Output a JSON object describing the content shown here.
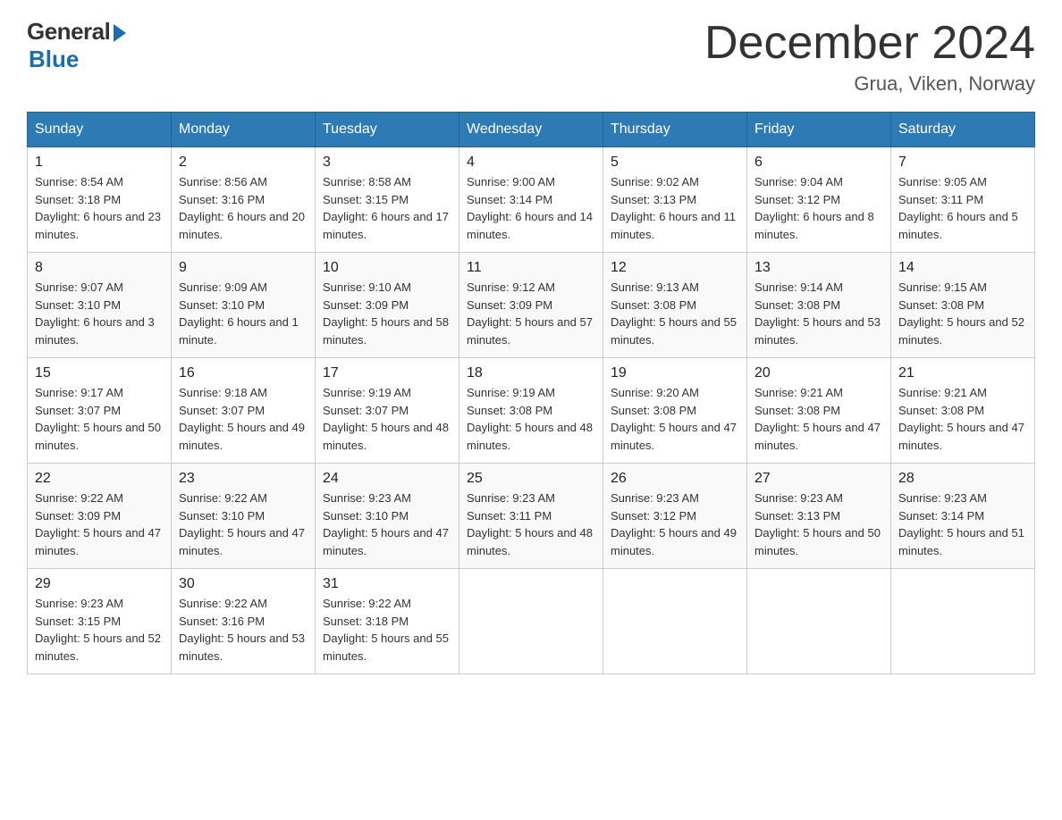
{
  "header": {
    "logo_general": "General",
    "logo_blue": "Blue",
    "month_title": "December 2024",
    "location": "Grua, Viken, Norway"
  },
  "days_of_week": [
    "Sunday",
    "Monday",
    "Tuesday",
    "Wednesday",
    "Thursday",
    "Friday",
    "Saturday"
  ],
  "weeks": [
    [
      {
        "day": "1",
        "sunrise": "8:54 AM",
        "sunset": "3:18 PM",
        "daylight": "6 hours and 23 minutes."
      },
      {
        "day": "2",
        "sunrise": "8:56 AM",
        "sunset": "3:16 PM",
        "daylight": "6 hours and 20 minutes."
      },
      {
        "day": "3",
        "sunrise": "8:58 AM",
        "sunset": "3:15 PM",
        "daylight": "6 hours and 17 minutes."
      },
      {
        "day": "4",
        "sunrise": "9:00 AM",
        "sunset": "3:14 PM",
        "daylight": "6 hours and 14 minutes."
      },
      {
        "day": "5",
        "sunrise": "9:02 AM",
        "sunset": "3:13 PM",
        "daylight": "6 hours and 11 minutes."
      },
      {
        "day": "6",
        "sunrise": "9:04 AM",
        "sunset": "3:12 PM",
        "daylight": "6 hours and 8 minutes."
      },
      {
        "day": "7",
        "sunrise": "9:05 AM",
        "sunset": "3:11 PM",
        "daylight": "6 hours and 5 minutes."
      }
    ],
    [
      {
        "day": "8",
        "sunrise": "9:07 AM",
        "sunset": "3:10 PM",
        "daylight": "6 hours and 3 minutes."
      },
      {
        "day": "9",
        "sunrise": "9:09 AM",
        "sunset": "3:10 PM",
        "daylight": "6 hours and 1 minute."
      },
      {
        "day": "10",
        "sunrise": "9:10 AM",
        "sunset": "3:09 PM",
        "daylight": "5 hours and 58 minutes."
      },
      {
        "day": "11",
        "sunrise": "9:12 AM",
        "sunset": "3:09 PM",
        "daylight": "5 hours and 57 minutes."
      },
      {
        "day": "12",
        "sunrise": "9:13 AM",
        "sunset": "3:08 PM",
        "daylight": "5 hours and 55 minutes."
      },
      {
        "day": "13",
        "sunrise": "9:14 AM",
        "sunset": "3:08 PM",
        "daylight": "5 hours and 53 minutes."
      },
      {
        "day": "14",
        "sunrise": "9:15 AM",
        "sunset": "3:08 PM",
        "daylight": "5 hours and 52 minutes."
      }
    ],
    [
      {
        "day": "15",
        "sunrise": "9:17 AM",
        "sunset": "3:07 PM",
        "daylight": "5 hours and 50 minutes."
      },
      {
        "day": "16",
        "sunrise": "9:18 AM",
        "sunset": "3:07 PM",
        "daylight": "5 hours and 49 minutes."
      },
      {
        "day": "17",
        "sunrise": "9:19 AM",
        "sunset": "3:07 PM",
        "daylight": "5 hours and 48 minutes."
      },
      {
        "day": "18",
        "sunrise": "9:19 AM",
        "sunset": "3:08 PM",
        "daylight": "5 hours and 48 minutes."
      },
      {
        "day": "19",
        "sunrise": "9:20 AM",
        "sunset": "3:08 PM",
        "daylight": "5 hours and 47 minutes."
      },
      {
        "day": "20",
        "sunrise": "9:21 AM",
        "sunset": "3:08 PM",
        "daylight": "5 hours and 47 minutes."
      },
      {
        "day": "21",
        "sunrise": "9:21 AM",
        "sunset": "3:08 PM",
        "daylight": "5 hours and 47 minutes."
      }
    ],
    [
      {
        "day": "22",
        "sunrise": "9:22 AM",
        "sunset": "3:09 PM",
        "daylight": "5 hours and 47 minutes."
      },
      {
        "day": "23",
        "sunrise": "9:22 AM",
        "sunset": "3:10 PM",
        "daylight": "5 hours and 47 minutes."
      },
      {
        "day": "24",
        "sunrise": "9:23 AM",
        "sunset": "3:10 PM",
        "daylight": "5 hours and 47 minutes."
      },
      {
        "day": "25",
        "sunrise": "9:23 AM",
        "sunset": "3:11 PM",
        "daylight": "5 hours and 48 minutes."
      },
      {
        "day": "26",
        "sunrise": "9:23 AM",
        "sunset": "3:12 PM",
        "daylight": "5 hours and 49 minutes."
      },
      {
        "day": "27",
        "sunrise": "9:23 AM",
        "sunset": "3:13 PM",
        "daylight": "5 hours and 50 minutes."
      },
      {
        "day": "28",
        "sunrise": "9:23 AM",
        "sunset": "3:14 PM",
        "daylight": "5 hours and 51 minutes."
      }
    ],
    [
      {
        "day": "29",
        "sunrise": "9:23 AM",
        "sunset": "3:15 PM",
        "daylight": "5 hours and 52 minutes."
      },
      {
        "day": "30",
        "sunrise": "9:22 AM",
        "sunset": "3:16 PM",
        "daylight": "5 hours and 53 minutes."
      },
      {
        "day": "31",
        "sunrise": "9:22 AM",
        "sunset": "3:18 PM",
        "daylight": "5 hours and 55 minutes."
      },
      null,
      null,
      null,
      null
    ]
  ],
  "labels": {
    "sunrise": "Sunrise:",
    "sunset": "Sunset:",
    "daylight": "Daylight:"
  }
}
